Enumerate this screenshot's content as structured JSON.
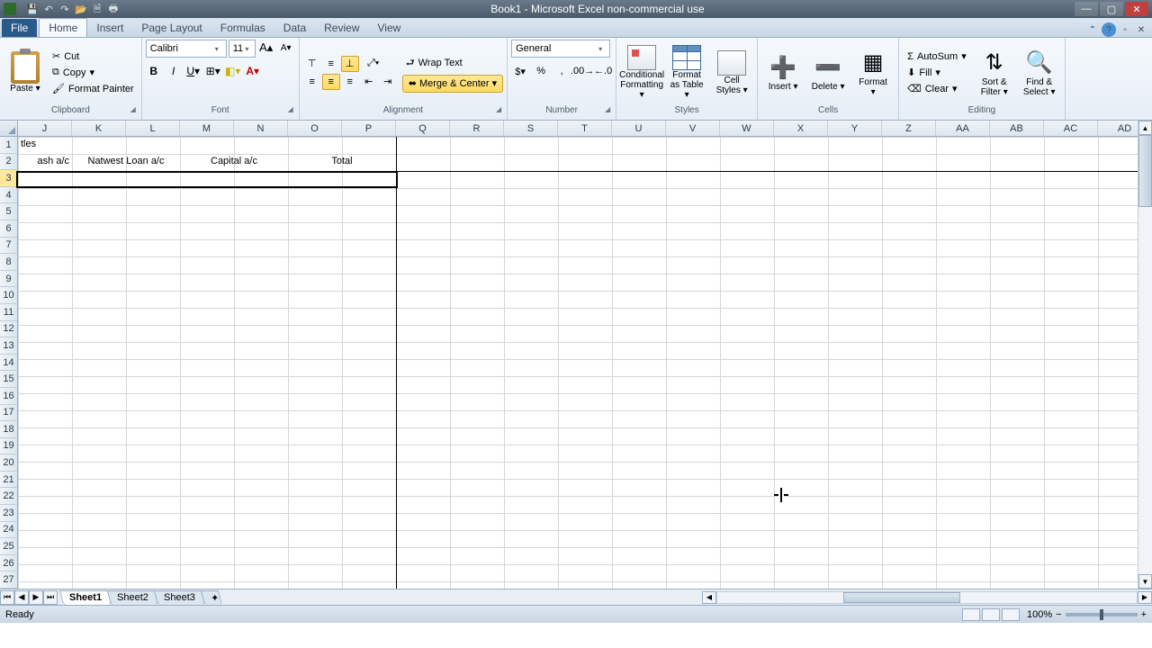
{
  "app": {
    "title": "Book1 - Microsoft Excel non-commercial use"
  },
  "ribbon_tabs": {
    "file": "File",
    "home": "Home",
    "insert": "Insert",
    "page_layout": "Page Layout",
    "formulas": "Formulas",
    "data": "Data",
    "review": "Review",
    "view": "View"
  },
  "clipboard": {
    "paste": "Paste",
    "cut": "Cut",
    "copy": "Copy",
    "format_painter": "Format Painter",
    "group": "Clipboard"
  },
  "font": {
    "name": "Calibri",
    "size": "11",
    "group": "Font"
  },
  "alignment": {
    "wrap": "Wrap Text",
    "merge": "Merge & Center",
    "group": "Alignment"
  },
  "number": {
    "format": "General",
    "group": "Number"
  },
  "styles": {
    "conditional": "Conditional Formatting",
    "as_table": "Format as Table",
    "cell": "Cell Styles",
    "group": "Styles"
  },
  "cells": {
    "insert": "Insert",
    "delete": "Delete",
    "format": "Format",
    "group": "Cells"
  },
  "editing": {
    "autosum": "AutoSum",
    "fill": "Fill",
    "clear": "Clear",
    "sort": "Sort & Filter",
    "find": "Find & Select",
    "group": "Editing"
  },
  "columns": [
    "J",
    "K",
    "L",
    "M",
    "N",
    "O",
    "P",
    "Q",
    "R",
    "S",
    "T",
    "U",
    "V",
    "W",
    "X",
    "Y",
    "Z",
    "AA",
    "AB",
    "AC",
    "AD"
  ],
  "rows": [
    "1",
    "2",
    "3",
    "4",
    "5",
    "6",
    "7",
    "8",
    "9",
    "10",
    "11",
    "12",
    "13",
    "14",
    "15",
    "16",
    "17",
    "18",
    "19",
    "20",
    "21",
    "22",
    "23",
    "24",
    "25",
    "26",
    "27"
  ],
  "selected_row": "3",
  "row1": {
    "j": "tles"
  },
  "row2": {
    "j": "ash a/c",
    "k_l": "Natwest Loan a/c",
    "m_n": "Capital a/c",
    "o_p": "Total"
  },
  "sheets": {
    "s1": "Sheet1",
    "s2": "Sheet2",
    "s3": "Sheet3"
  },
  "status": {
    "ready": "Ready",
    "zoom": "100%"
  }
}
